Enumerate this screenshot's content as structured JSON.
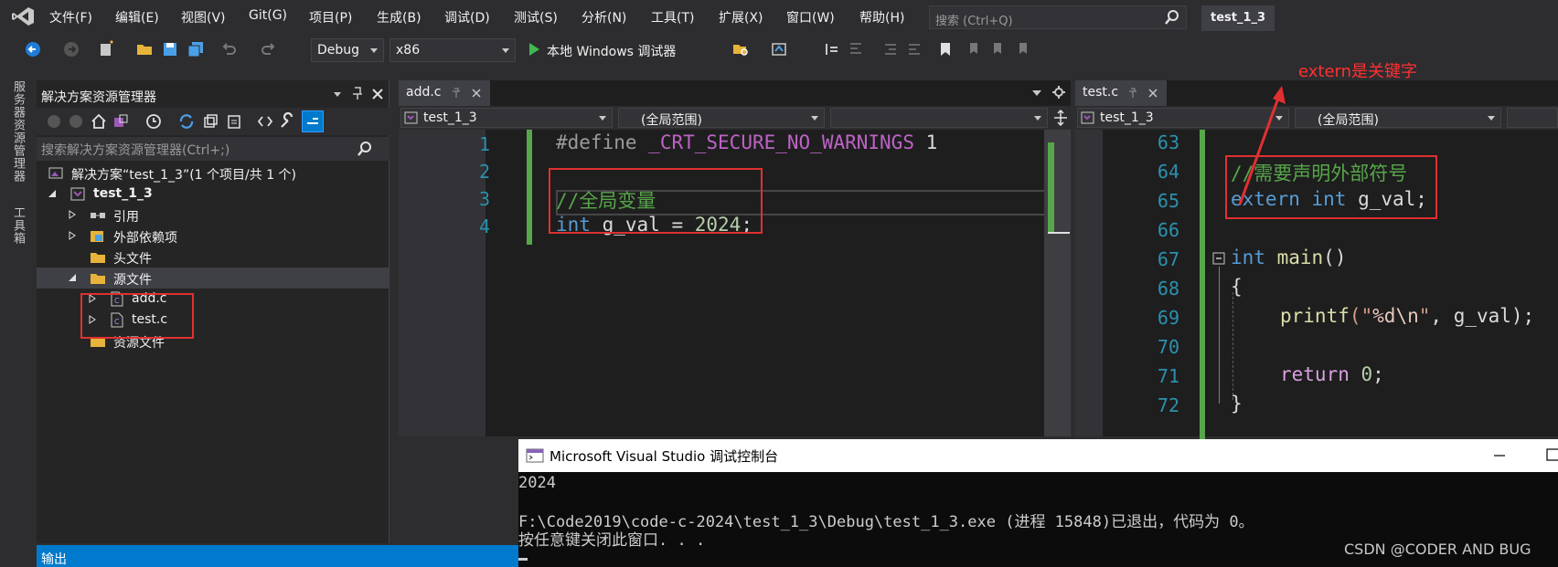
{
  "menu": {
    "items": [
      "文件(F)",
      "编辑(E)",
      "视图(V)",
      "Git(G)",
      "项目(P)",
      "生成(B)",
      "调试(D)",
      "测试(S)",
      "分析(N)",
      "工具(T)",
      "扩展(X)",
      "窗口(W)",
      "帮助(H)"
    ],
    "search_placeholder": "搜索 (Ctrl+Q)",
    "solution_name": "test_1_3"
  },
  "toolbar": {
    "config": "Debug",
    "platform": "x86",
    "run_label": "本地 Windows 调试器"
  },
  "left_strip": {
    "server_explorer": "服务器资源管理器",
    "toolbox": "工具箱"
  },
  "solution_explorer": {
    "title": "解决方案资源管理器",
    "search_placeholder": "搜索解决方案资源管理器(Ctrl+;)",
    "items": [
      {
        "label": "解决方案“test_1_3”(1 个项目/共 1 个)"
      },
      {
        "label": "test_1_3"
      },
      {
        "label": "引用"
      },
      {
        "label": "外部依赖项"
      },
      {
        "label": "头文件"
      },
      {
        "label": "源文件"
      },
      {
        "label": "add.c"
      },
      {
        "label": "test.c"
      },
      {
        "label": "资源文件"
      }
    ]
  },
  "output_panel": {
    "title": "输出"
  },
  "editor_add": {
    "tab": "add.c",
    "scope_project": "test_1_3",
    "scope_global": "(全局范围)",
    "line_numbers": [
      "1",
      "2",
      "3",
      "4"
    ],
    "lines": {
      "l1_directive": "#define",
      "l1_macro": "_CRT_SECURE_NO_WARNINGS",
      "l1_value": "1",
      "l3_comment": "//全局变量",
      "l4_type": "int",
      "l4_rest": " g_val = ",
      "l4_num": "2024",
      "l4_end": ";"
    }
  },
  "editor_test": {
    "tab": "test.c",
    "scope_project": "test_1_3",
    "scope_global": "(全局范围)",
    "line_numbers": [
      "63",
      "64",
      "65",
      "66",
      "67",
      "68",
      "69",
      "70",
      "71",
      "72"
    ],
    "lines": {
      "l64_comment": "//需要声明外部符号",
      "l65_extern": "extern",
      "l65_int": "int",
      "l65_rest": " g_val;",
      "l67_int": "int",
      "l67_main": "main",
      "l67_rest": "()",
      "l68": "{",
      "l69_fn": "printf",
      "l69_open": "(\"",
      "l69_fmt": "%d",
      "l69_esc": "\\n",
      "l69_close": "\"",
      "l69_rest": ", g_val);",
      "l71_ret": "return",
      "l71_num": "0",
      "l71_end": ";",
      "l72": "}"
    }
  },
  "console": {
    "title": "Microsoft Visual Studio 调试控制台",
    "lines": [
      "2024",
      "F:\\Code2019\\code-c-2024\\test_1_3\\Debug\\test_1_3.exe (进程 15848)已退出，代码为 0。",
      "按任意键关闭此窗口. . ."
    ]
  },
  "annotation": "extern是关键字",
  "watermark": "CSDN @CODER AND BUG",
  "colors": {
    "accent": "#007acc",
    "annotation_red": "#e03030",
    "comment_green": "#57a64a"
  }
}
